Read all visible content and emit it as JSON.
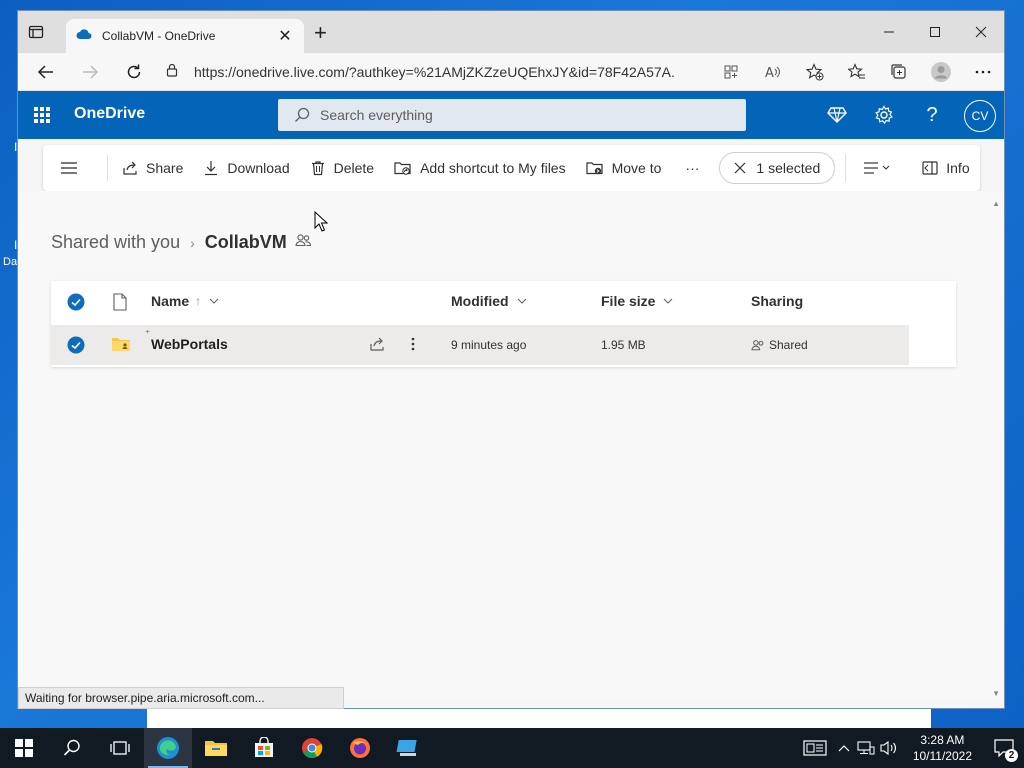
{
  "desktop": {
    "fragments": [
      "I",
      "I",
      "Da"
    ]
  },
  "browser": {
    "tab_title": "CollabVM - OneDrive",
    "url": "https://onedrive.live.com/?authkey=%21AMjZKZzeUQEhxJY&id=78F42A57A..."
  },
  "onedrive": {
    "brand": "OneDrive",
    "search_placeholder": "Search everything",
    "avatar_initials": "CV"
  },
  "commands": {
    "share": "Share",
    "download": "Download",
    "delete": "Delete",
    "add_shortcut": "Add shortcut to My files",
    "move_to": "Move to",
    "more": "···",
    "selected": "1 selected",
    "info": "Info"
  },
  "breadcrumb": {
    "parent": "Shared with you",
    "current": "CollabVM"
  },
  "table": {
    "columns": {
      "name": "Name",
      "modified": "Modified",
      "size": "File size",
      "sharing": "Sharing"
    },
    "sort_indicator": "↑",
    "rows": [
      {
        "name": "WebPortals",
        "modified": "9 minutes ago",
        "size": "1.95 MB",
        "sharing": "Shared",
        "selected": true
      }
    ]
  },
  "status": "Waiting for browser.pipe.aria.microsoft.com...",
  "taskbar": {
    "time": "3:28 AM",
    "date": "10/11/2022",
    "notification_count": "2"
  },
  "colors": {
    "onedrive_blue": "#0364b8",
    "selection_check": "#0f6cbd",
    "taskbar": "#111922"
  }
}
